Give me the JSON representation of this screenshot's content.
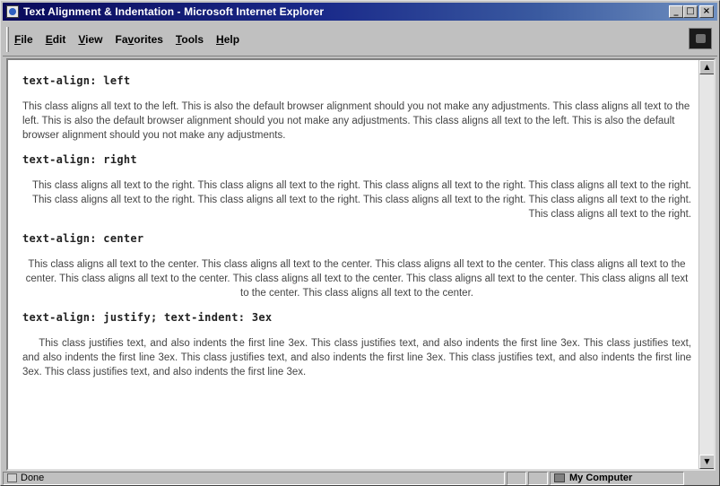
{
  "window": {
    "title": "Text Alignment & Indentation - Microsoft Internet Explorer",
    "buttons": {
      "minimize": "_",
      "maximize": "□",
      "close": "×"
    }
  },
  "menu": {
    "items": [
      {
        "label_first": "F",
        "label_rest": "ile"
      },
      {
        "label_first": "E",
        "label_rest": "dit"
      },
      {
        "label_first": "V",
        "label_rest": "iew"
      },
      {
        "label_first": "F",
        "label_rest": "a",
        "label_u2": "v",
        "label_tail": "orites"
      },
      {
        "label_first": "T",
        "label_rest": "ools"
      },
      {
        "label_first": "H",
        "label_rest": "elp"
      }
    ]
  },
  "content": {
    "sections": [
      {
        "heading": "text-align: left",
        "text": "This class aligns all text to the left. This is also the default browser alignment should you not make any adjustments. This class aligns all text to the left. This is also the default browser alignment should you not make any adjustments. This class aligns all text to the left. This is also the default browser alignment should you not make any adjustments."
      },
      {
        "heading": "text-align: right",
        "text": "This class aligns all text to the right. This class aligns all text to the right. This class aligns all text to the right. This class aligns all text to the right. This class aligns all text to the right. This class aligns all text to the right. This class aligns all text to the right. This class aligns all text to the right. This class aligns all text to the right."
      },
      {
        "heading": "text-align: center",
        "text": "This class aligns all text to the center. This class aligns all text to the center. This class aligns all text to the center. This class aligns all text to the center. This class aligns all text to the center. This class aligns all text to the center. This class aligns all text to the center. This class aligns all text to the center. This class aligns all text to the center."
      },
      {
        "heading": "text-align: justify; text-indent: 3ex",
        "text": "This class justifies text, and also indents the first line 3ex. This class justifies text, and also indents the first line 3ex. This class justifies text, and also indents the first line 3ex. This class justifies text, and also indents the first line 3ex. This class justifies text, and also indents the first line 3ex. This class justifies text, and also indents the first line 3ex."
      }
    ]
  },
  "scrollbar": {
    "up": "▲",
    "down": "▼"
  },
  "status": {
    "text": "Done",
    "zone": "My Computer"
  }
}
